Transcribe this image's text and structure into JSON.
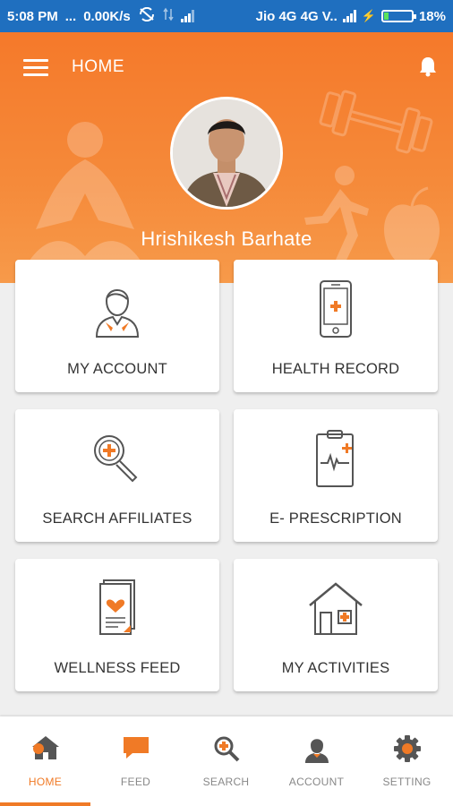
{
  "status_bar": {
    "time": "5:08 PM",
    "dots": "...",
    "net_speed": "0.00K/s",
    "carrier": "Jio 4G 4G V..",
    "battery": "18%",
    "battery_level": 0.18
  },
  "header": {
    "title": "HOME"
  },
  "profile": {
    "name": "Hrishikesh Barhate"
  },
  "tiles": [
    {
      "label": "MY ACCOUNT",
      "icon": "account-icon"
    },
    {
      "label": "HEALTH RECORD",
      "icon": "phone-plus-icon"
    },
    {
      "label": "SEARCH AFFILIATES",
      "icon": "magnifier-plus-icon"
    },
    {
      "label": "E- PRESCRIPTION",
      "icon": "clipboard-ecg-icon"
    },
    {
      "label": "WELLNESS FEED",
      "icon": "heart-document-icon"
    },
    {
      "label": "MY ACTIVITIES",
      "icon": "house-icon"
    }
  ],
  "bottom_nav": [
    {
      "label": "HOME",
      "icon": "home-icon",
      "active": true
    },
    {
      "label": "FEED",
      "icon": "chat-icon"
    },
    {
      "label": "SEARCH",
      "icon": "search-icon"
    },
    {
      "label": "ACCOUNT",
      "icon": "user-icon"
    },
    {
      "label": "SETTING",
      "icon": "gear-icon"
    }
  ],
  "colors": {
    "accent": "#f07a26",
    "status_bar": "#1f6fbf",
    "card": "#ffffff",
    "icon_dark": "#555555"
  }
}
